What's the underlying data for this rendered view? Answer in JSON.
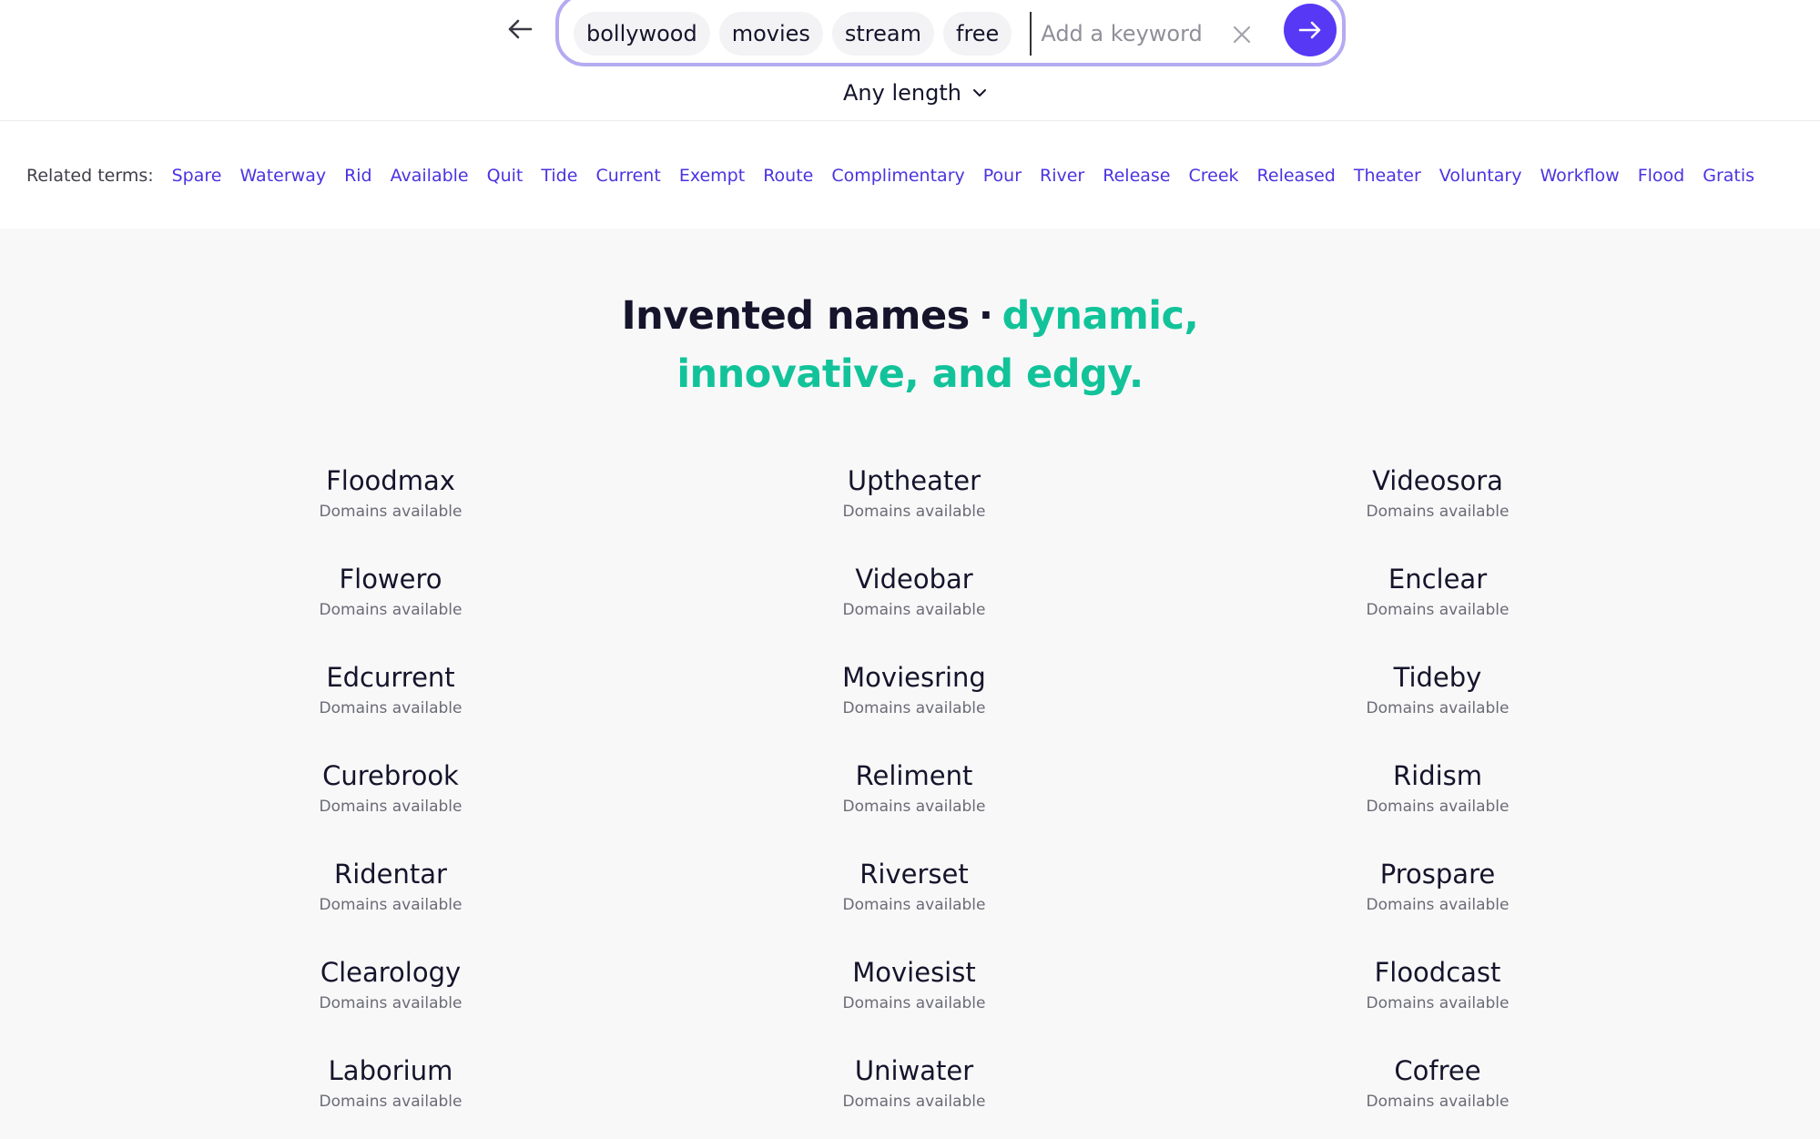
{
  "search": {
    "chips": [
      "bollywood",
      "movies",
      "stream",
      "free"
    ],
    "placeholder": "Add a keyword",
    "length_label": "Any length"
  },
  "related": {
    "label": "Related terms:",
    "terms": [
      "Spare",
      "Waterway",
      "Rid",
      "Available",
      "Quit",
      "Tide",
      "Current",
      "Exempt",
      "Route",
      "Complimentary",
      "Pour",
      "River",
      "Release",
      "Creek",
      "Released",
      "Theater",
      "Voluntary",
      "Workflow",
      "Flood",
      "Gratis"
    ]
  },
  "headline": {
    "dark": "Invented names",
    "separator": "·",
    "accent_line1": "dynamic,",
    "accent_line2": "innovative, and edgy."
  },
  "colors": {
    "accent_purple": "#5738f5",
    "accent_green": "#12c39a",
    "link": "#4b33e0",
    "search_border": "#b4abf2"
  },
  "names": {
    "subtitle": "Domains available",
    "rows": [
      [
        "Floodmax",
        "Uptheater",
        "Videosora"
      ],
      [
        "Flowero",
        "Videobar",
        "Enclear"
      ],
      [
        "Edcurrent",
        "Moviesring",
        "Tideby"
      ],
      [
        "Curebrook",
        "Reliment",
        "Ridism"
      ],
      [
        "Ridentar",
        "Riverset",
        "Prospare"
      ],
      [
        "Clearology",
        "Moviesist",
        "Floodcast"
      ],
      [
        "Laborium",
        "Uniwater",
        "Cofree"
      ]
    ]
  }
}
